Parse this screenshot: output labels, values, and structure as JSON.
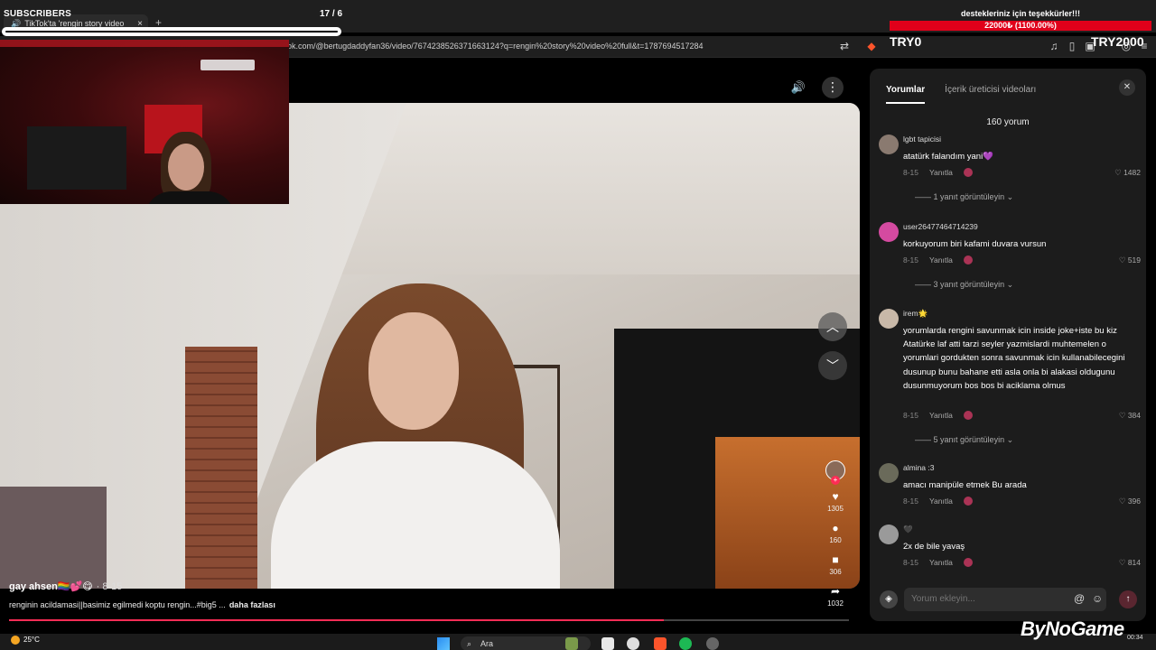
{
  "browser": {
    "tab_title": "TikTok'ta 'rengin story video",
    "new_tab": "+",
    "url": "ok.com/@bertugdaddyfan36/video/7674238526371663124?q=rengin%20story%20video%20full&t=1787694517284"
  },
  "overlay": {
    "subscribers_label": "SUBSCRIBERS",
    "subscribers_count": "17 / 6",
    "goal_thanks": "destekleriniz için teşekkürler!!!",
    "goal_amount": "22000₺ (1100.00%)",
    "goal_left": "TRY0",
    "goal_right": "TRY2000",
    "goal_bar_color": "#e0001a"
  },
  "video": {
    "author": "gay ahsen🏳️‍🌈💕😋",
    "date": "· 8-15",
    "description": "renginin acildamasi||basimiz egilmedi koptu rengin...#big5 ...",
    "more_label": "daha fazlası",
    "progress": 0.78,
    "likes": "1305",
    "comments": "160",
    "saves": "306",
    "shares": "1032",
    "accent": "#fe2c55"
  },
  "comments_panel": {
    "tabs": [
      "Yorumlar",
      "İçerik üreticisi videoları"
    ],
    "count": "160 yorum",
    "input_placeholder": "Yorum ekleyin...",
    "reply_label": "Yanıtla",
    "items": [
      {
        "user": "lgbt tapicisi",
        "text": "atatürk falandım yani💜",
        "date": "8-15",
        "likes": "1482",
        "replies": "1 yanıt görüntüleyin",
        "avatar_color": "#8a7a70"
      },
      {
        "user": "user26477464714239",
        "text": "korkuyorum biri kafami duvara vursun",
        "date": "8-15",
        "likes": "519",
        "replies": "3 yanıt görüntüleyin",
        "avatar_color": "#d44aa0"
      },
      {
        "user": "irem🌟",
        "text": "yorumlarda rengini savunmak icin inside joke+iste bu kiz Atatürke laf atti tarzi seyler yazmislardi muhtemelen o yorumlari gordukten sonra savunmak icin kullanabilecegini dusunup bunu bahane etti asla onla bi alakasi oldugunu dusunmuyorum bos bos bi aciklama olmus",
        "date": "8-15",
        "likes": "384",
        "replies": "5 yanıt görüntüleyin",
        "avatar_color": "#c8b8a8"
      },
      {
        "user": "almina :3",
        "text": "amacı manipüle etmek Bu arada",
        "date": "8-15",
        "likes": "396",
        "replies": "",
        "avatar_color": "#6a6a5a"
      },
      {
        "user": "🖤",
        "text": "2x de bile yavaş",
        "date": "8-15",
        "likes": "814",
        "replies": "",
        "avatar_color": "#9a9a9a"
      }
    ]
  },
  "taskbar": {
    "weather": "25°C",
    "search": "Ara",
    "clock": "00:34"
  },
  "brand": "ByNoGame"
}
